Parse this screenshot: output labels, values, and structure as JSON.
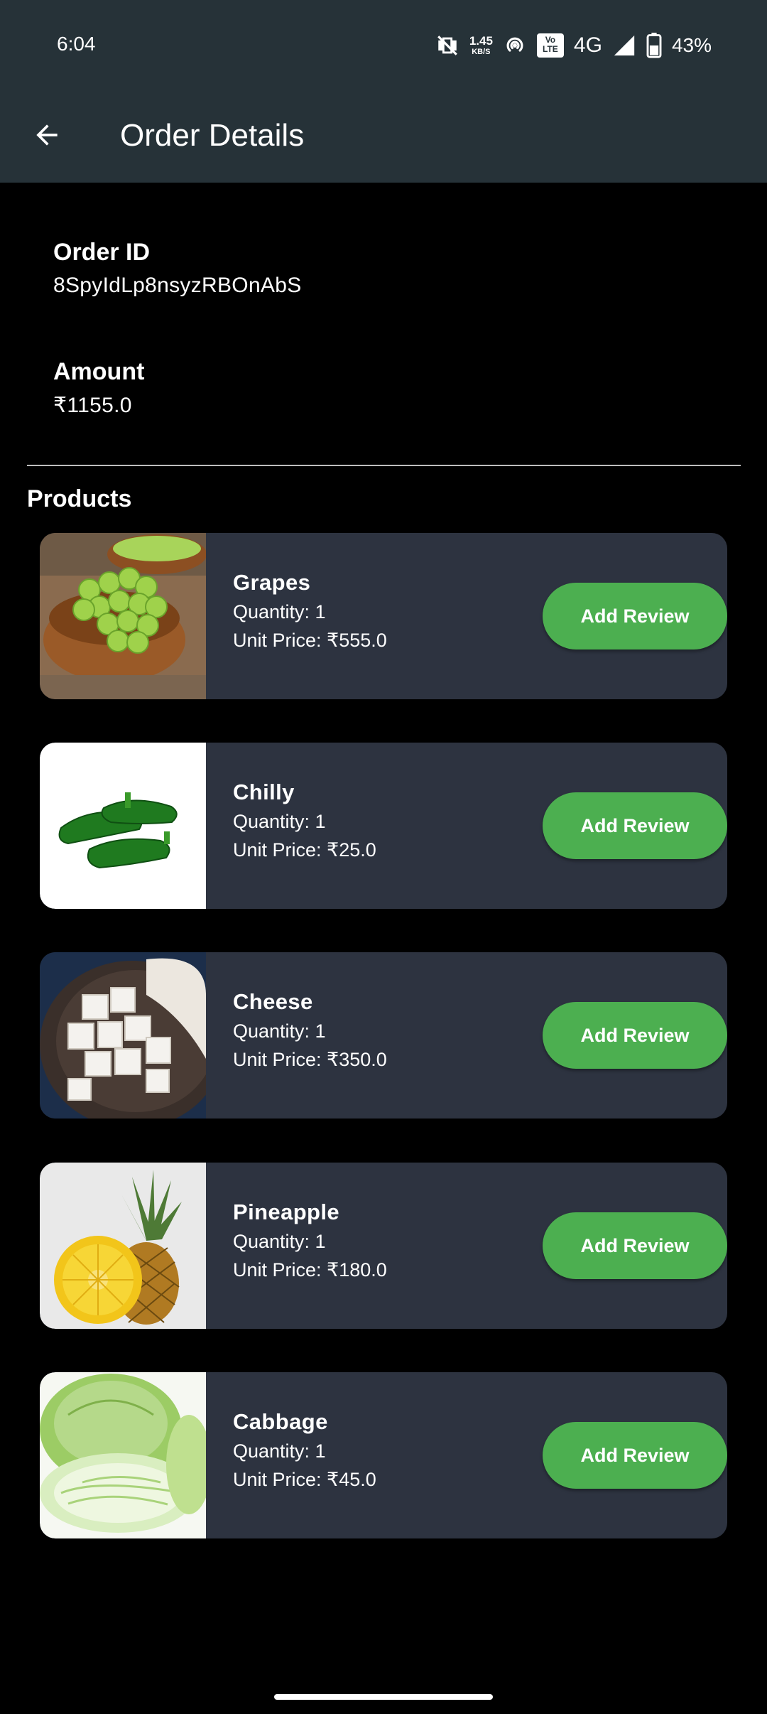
{
  "status_bar": {
    "time": "6:04",
    "net_speed_value": "1.45",
    "net_speed_unit": "KB/S",
    "volte": "Vo LTE",
    "network": "4G",
    "battery": "43%"
  },
  "app_bar": {
    "title": "Order Details"
  },
  "order": {
    "id_label": "Order ID",
    "id_value": "8SpyIdLp8nsyzRBOnAbS",
    "amount_label": "Amount",
    "amount_value": "₹1155.0"
  },
  "products_title": "Products",
  "products": [
    {
      "name": "Grapes",
      "quantity": "Quantity: 1",
      "unit_price": "Unit Price: ₹555.0",
      "review_label": "Add Review",
      "image": "grapes-image"
    },
    {
      "name": "Chilly",
      "quantity": "Quantity: 1",
      "unit_price": "Unit Price: ₹25.0",
      "review_label": "Add Review",
      "image": "chilly-image"
    },
    {
      "name": "Cheese",
      "quantity": "Quantity: 1",
      "unit_price": "Unit Price: ₹350.0",
      "review_label": "Add Review",
      "image": "cheese-image"
    },
    {
      "name": "Pineapple",
      "quantity": "Quantity: 1",
      "unit_price": "Unit Price: ₹180.0",
      "review_label": "Add Review",
      "image": "pineapple-image"
    },
    {
      "name": "Cabbage",
      "quantity": "Quantity: 1",
      "unit_price": "Unit Price: ₹45.0",
      "review_label": "Add Review",
      "image": "cabbage-image"
    }
  ],
  "colors": {
    "app_bar": "#263238",
    "background": "#000000",
    "card": "#2d3340",
    "button": "#4caf50"
  }
}
